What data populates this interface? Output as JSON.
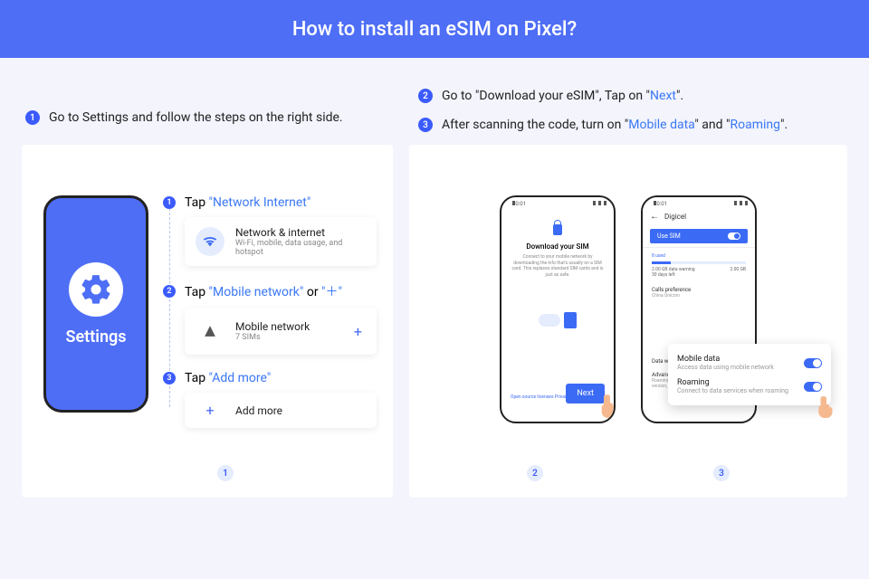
{
  "header": {
    "title": "How to install an eSIM on Pixel?"
  },
  "top_steps": {
    "s1": {
      "num": "1",
      "text": "Go to Settings and follow the steps on the right side."
    },
    "s2": {
      "num": "2",
      "before": "Go to \"Download your eSIM\", Tap on \"",
      "hl": "Next",
      "after": "\"."
    },
    "s3": {
      "num": "3",
      "before": "After scanning the code, turn on \"",
      "hl1": "Mobile data",
      "mid": "\" and \"",
      "hl2": "Roaming",
      "after": "\"."
    }
  },
  "settings_phone": {
    "label": "Settings"
  },
  "substeps": {
    "a": {
      "num": "1",
      "before": "Tap ",
      "hl": "\"Network Internet\"",
      "card_title": "Network & internet",
      "card_sub": "Wi-Fi, mobile, data usage, and hotspot"
    },
    "b": {
      "num": "2",
      "before": "Tap ",
      "hl1": "\"Mobile network\"",
      "mid": " or ",
      "hl2": "\"＋\"",
      "card_title": "Mobile network",
      "card_sub": "7 SIMs"
    },
    "c": {
      "num": "3",
      "before": "Tap ",
      "hl": "\"Add more\"",
      "card_title": "Add more"
    }
  },
  "phone2": {
    "title": "Download your SIM",
    "desc": "Connect to your mobile network by downloading the info that's usually on a SIM card. This replaces standard SIM cards and is just as safe.",
    "next": "Next",
    "privacy": "Open source licenses  Privacy poli"
  },
  "phone3": {
    "carrier": "Digicel",
    "use_sim": "Use SIM",
    "section_lbl": "8 used",
    "data_warn": "2.00 GB data warning",
    "days": "30 days left",
    "limit": "2.00 GB",
    "calls_pref": "Calls preference",
    "calls_sub": "China Unicom",
    "dw": "Data warning & limit",
    "adv": "Advanced",
    "adv_sub": "Roaming, Preferred network type, Settings version, Ca..."
  },
  "overlay": {
    "r1": {
      "t1": "Mobile data",
      "t2": "Access data using mobile network"
    },
    "r2": {
      "t1": "Roaming",
      "t2": "Connect to data services when roaming"
    }
  },
  "badges": {
    "b1": "1",
    "b2": "2",
    "b3": "3"
  }
}
